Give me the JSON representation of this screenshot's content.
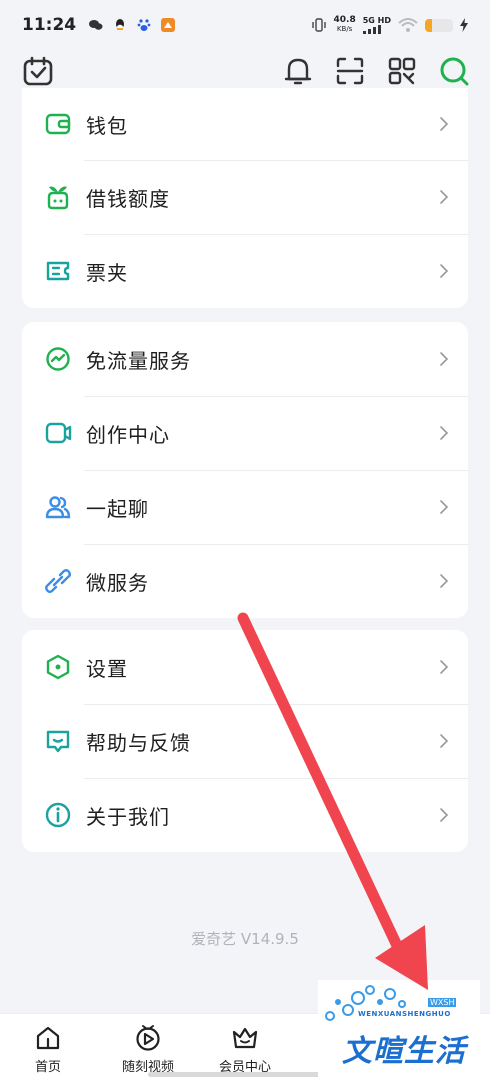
{
  "status_bar": {
    "time": "11:24",
    "net_speed": "40.8",
    "net_unit": "KB/s",
    "network": "5G HD",
    "battery_level": 0.25
  },
  "top_bar": {
    "icons": [
      "calendar-check-icon",
      "bell-icon",
      "scan-icon",
      "qr-code-icon",
      "search-icon"
    ],
    "accent": "#1fb14f"
  },
  "groups": [
    {
      "items": [
        {
          "label": "钱包",
          "icon": "wallet-icon"
        },
        {
          "label": "借钱额度",
          "icon": "sprout-icon"
        },
        {
          "label": "票夹",
          "icon": "ticket-icon"
        }
      ]
    },
    {
      "items": [
        {
          "label": "免流量服务",
          "icon": "traffic-icon"
        },
        {
          "label": "创作中心",
          "icon": "video-camera-icon"
        },
        {
          "label": "一起聊",
          "icon": "people-icon"
        },
        {
          "label": "微服务",
          "icon": "link-icon"
        }
      ]
    },
    {
      "items": [
        {
          "label": "设置",
          "icon": "hexagon-icon"
        },
        {
          "label": "帮助与反馈",
          "icon": "chat-icon"
        },
        {
          "label": "关于我们",
          "icon": "info-icon"
        }
      ]
    }
  ],
  "version": "爱奇艺 V14.9.5",
  "bottom_nav": [
    {
      "label": "首页",
      "icon": "home-icon"
    },
    {
      "label": "随刻视频",
      "icon": "play-circle-icon"
    },
    {
      "label": "会员中心",
      "icon": "crown-icon"
    }
  ],
  "watermark": {
    "title": "文暄生活",
    "subtitle": "WENXUANSHENGHUO",
    "badge": "WXSH"
  },
  "colors": {
    "green": "#1fb14f",
    "teal": "#1aa39e",
    "arrow": "#f0454f"
  }
}
